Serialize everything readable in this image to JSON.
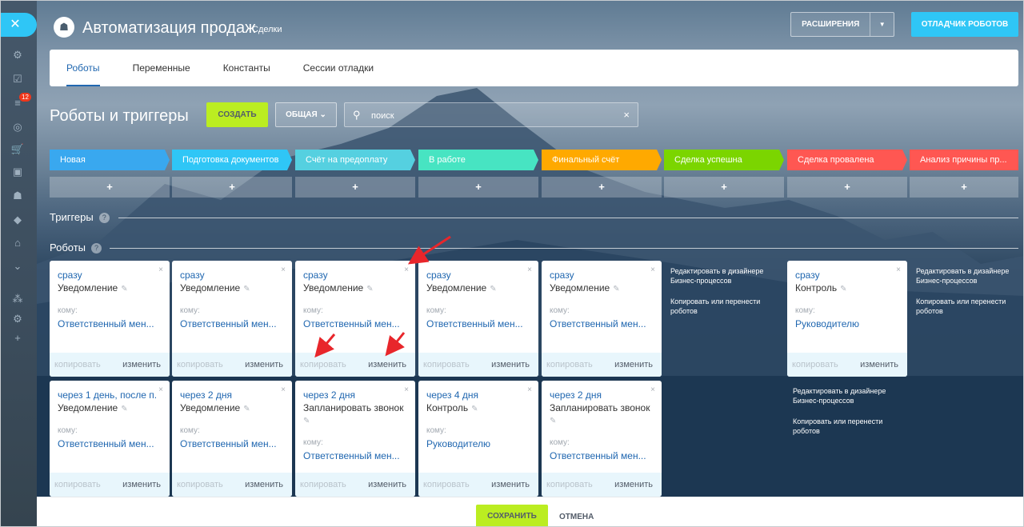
{
  "header": {
    "title": "Автоматизация продаж",
    "subtitle": "Сделки",
    "extensions_label": "РАСШИРЕНИЯ",
    "debugger_label": "ОТЛАДЧИК РОБОТОВ"
  },
  "sidebar": {
    "badge": "12"
  },
  "tabs": [
    "Роботы",
    "Переменные",
    "Константы",
    "Сессии отладки"
  ],
  "toolbar": {
    "title": "Роботы и триггеры",
    "create_label": "СОЗДАТЬ",
    "general_label": "ОБЩАЯ",
    "search_placeholder": "поиск"
  },
  "stages": [
    {
      "label": "Новая",
      "color": "#39a8ef"
    },
    {
      "label": "Подготовка документов",
      "color": "#2fc6f6"
    },
    {
      "label": "Счёт на предоплату",
      "color": "#55d0e0"
    },
    {
      "label": "В работе",
      "color": "#47e4c2"
    },
    {
      "label": "Финальный счёт",
      "color": "#ffa900"
    },
    {
      "label": "Сделка успешна",
      "color": "#7bd500"
    },
    {
      "label": "Сделка провалена",
      "color": "#ff5752"
    },
    {
      "label": "Анализ причины пр...",
      "color": "#ff5752"
    }
  ],
  "plus_label": "+",
  "sections": {
    "triggers": "Триггеры",
    "robots": "Роботы",
    "help": "?"
  },
  "card_labels": {
    "to": "кому:",
    "copy": "копировать",
    "edit": "изменить",
    "close": "×"
  },
  "cards_row1": [
    {
      "when": "сразу",
      "name": "Уведомление",
      "target": "Ответственный мен..."
    },
    {
      "when": "сразу",
      "name": "Уведомление",
      "target": "Ответственный мен..."
    },
    {
      "when": "сразу",
      "name": "Уведомление",
      "target": "Ответственный мен..."
    },
    {
      "when": "сразу",
      "name": "Уведомление",
      "target": "Ответственный мен..."
    },
    {
      "when": "сразу",
      "name": "Уведомление",
      "target": "Ответственный мен..."
    },
    {
      "when": "сразу",
      "name": "Контроль",
      "target": "Руководителю"
    }
  ],
  "cards_row2": [
    {
      "when": "через 1 день, после п...",
      "name": "Уведомление",
      "target": "Ответственный мен..."
    },
    {
      "when": "через 2 дня",
      "name": "Уведомление",
      "target": "Ответственный мен..."
    },
    {
      "when": "через 2 дня",
      "name": "Запланировать звонок",
      "target": "Ответственный мен..."
    },
    {
      "when": "через 4 дня",
      "name": "Контроль",
      "target": "Руководителю"
    },
    {
      "when": "через 2 дня",
      "name": "Запланировать звонок",
      "target": "Ответственный мен..."
    }
  ],
  "hints": {
    "edit_in_designer": "Редактировать в дизайнере Бизнес-процессов",
    "copy_or_move": "Копировать или перенести роботов"
  },
  "footer": {
    "save_label": "СОХРАНИТЬ",
    "cancel_label": "ОТМЕНА"
  }
}
